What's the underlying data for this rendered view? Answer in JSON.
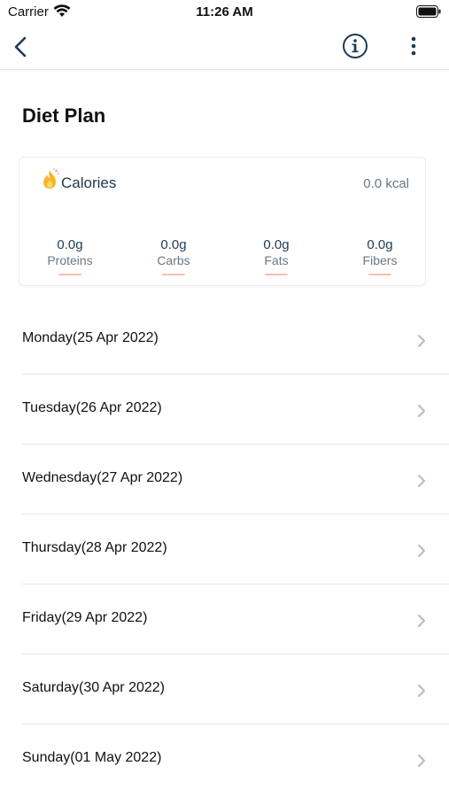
{
  "status_bar": {
    "carrier": "Carrier",
    "time": "11:26 AM"
  },
  "nav": {
    "back_icon": "chevron-left-icon",
    "info_icon": "info-circle-icon",
    "more_icon": "more-vertical-icon",
    "icon_color": "#1f3a52"
  },
  "page": {
    "title": "Diet Plan"
  },
  "calories_card": {
    "icon": "flame-icon",
    "label": "Calories",
    "value": "0.0 kcal",
    "macros": [
      {
        "value": "0.0g",
        "label": "Proteins"
      },
      {
        "value": "0.0g",
        "label": "Carbs"
      },
      {
        "value": "0.0g",
        "label": "Fats"
      },
      {
        "value": "0.0g",
        "label": "Fibers"
      }
    ],
    "accent_color": "#f4c2ae"
  },
  "days": [
    {
      "label": "Monday(25 Apr 2022)"
    },
    {
      "label": "Tuesday(26 Apr 2022)"
    },
    {
      "label": "Wednesday(27 Apr 2022)"
    },
    {
      "label": "Thursday(28 Apr 2022)"
    },
    {
      "label": "Friday(29 Apr 2022)"
    },
    {
      "label": "Saturday(30 Apr 2022)"
    },
    {
      "label": "Sunday(01 May 2022)"
    }
  ]
}
